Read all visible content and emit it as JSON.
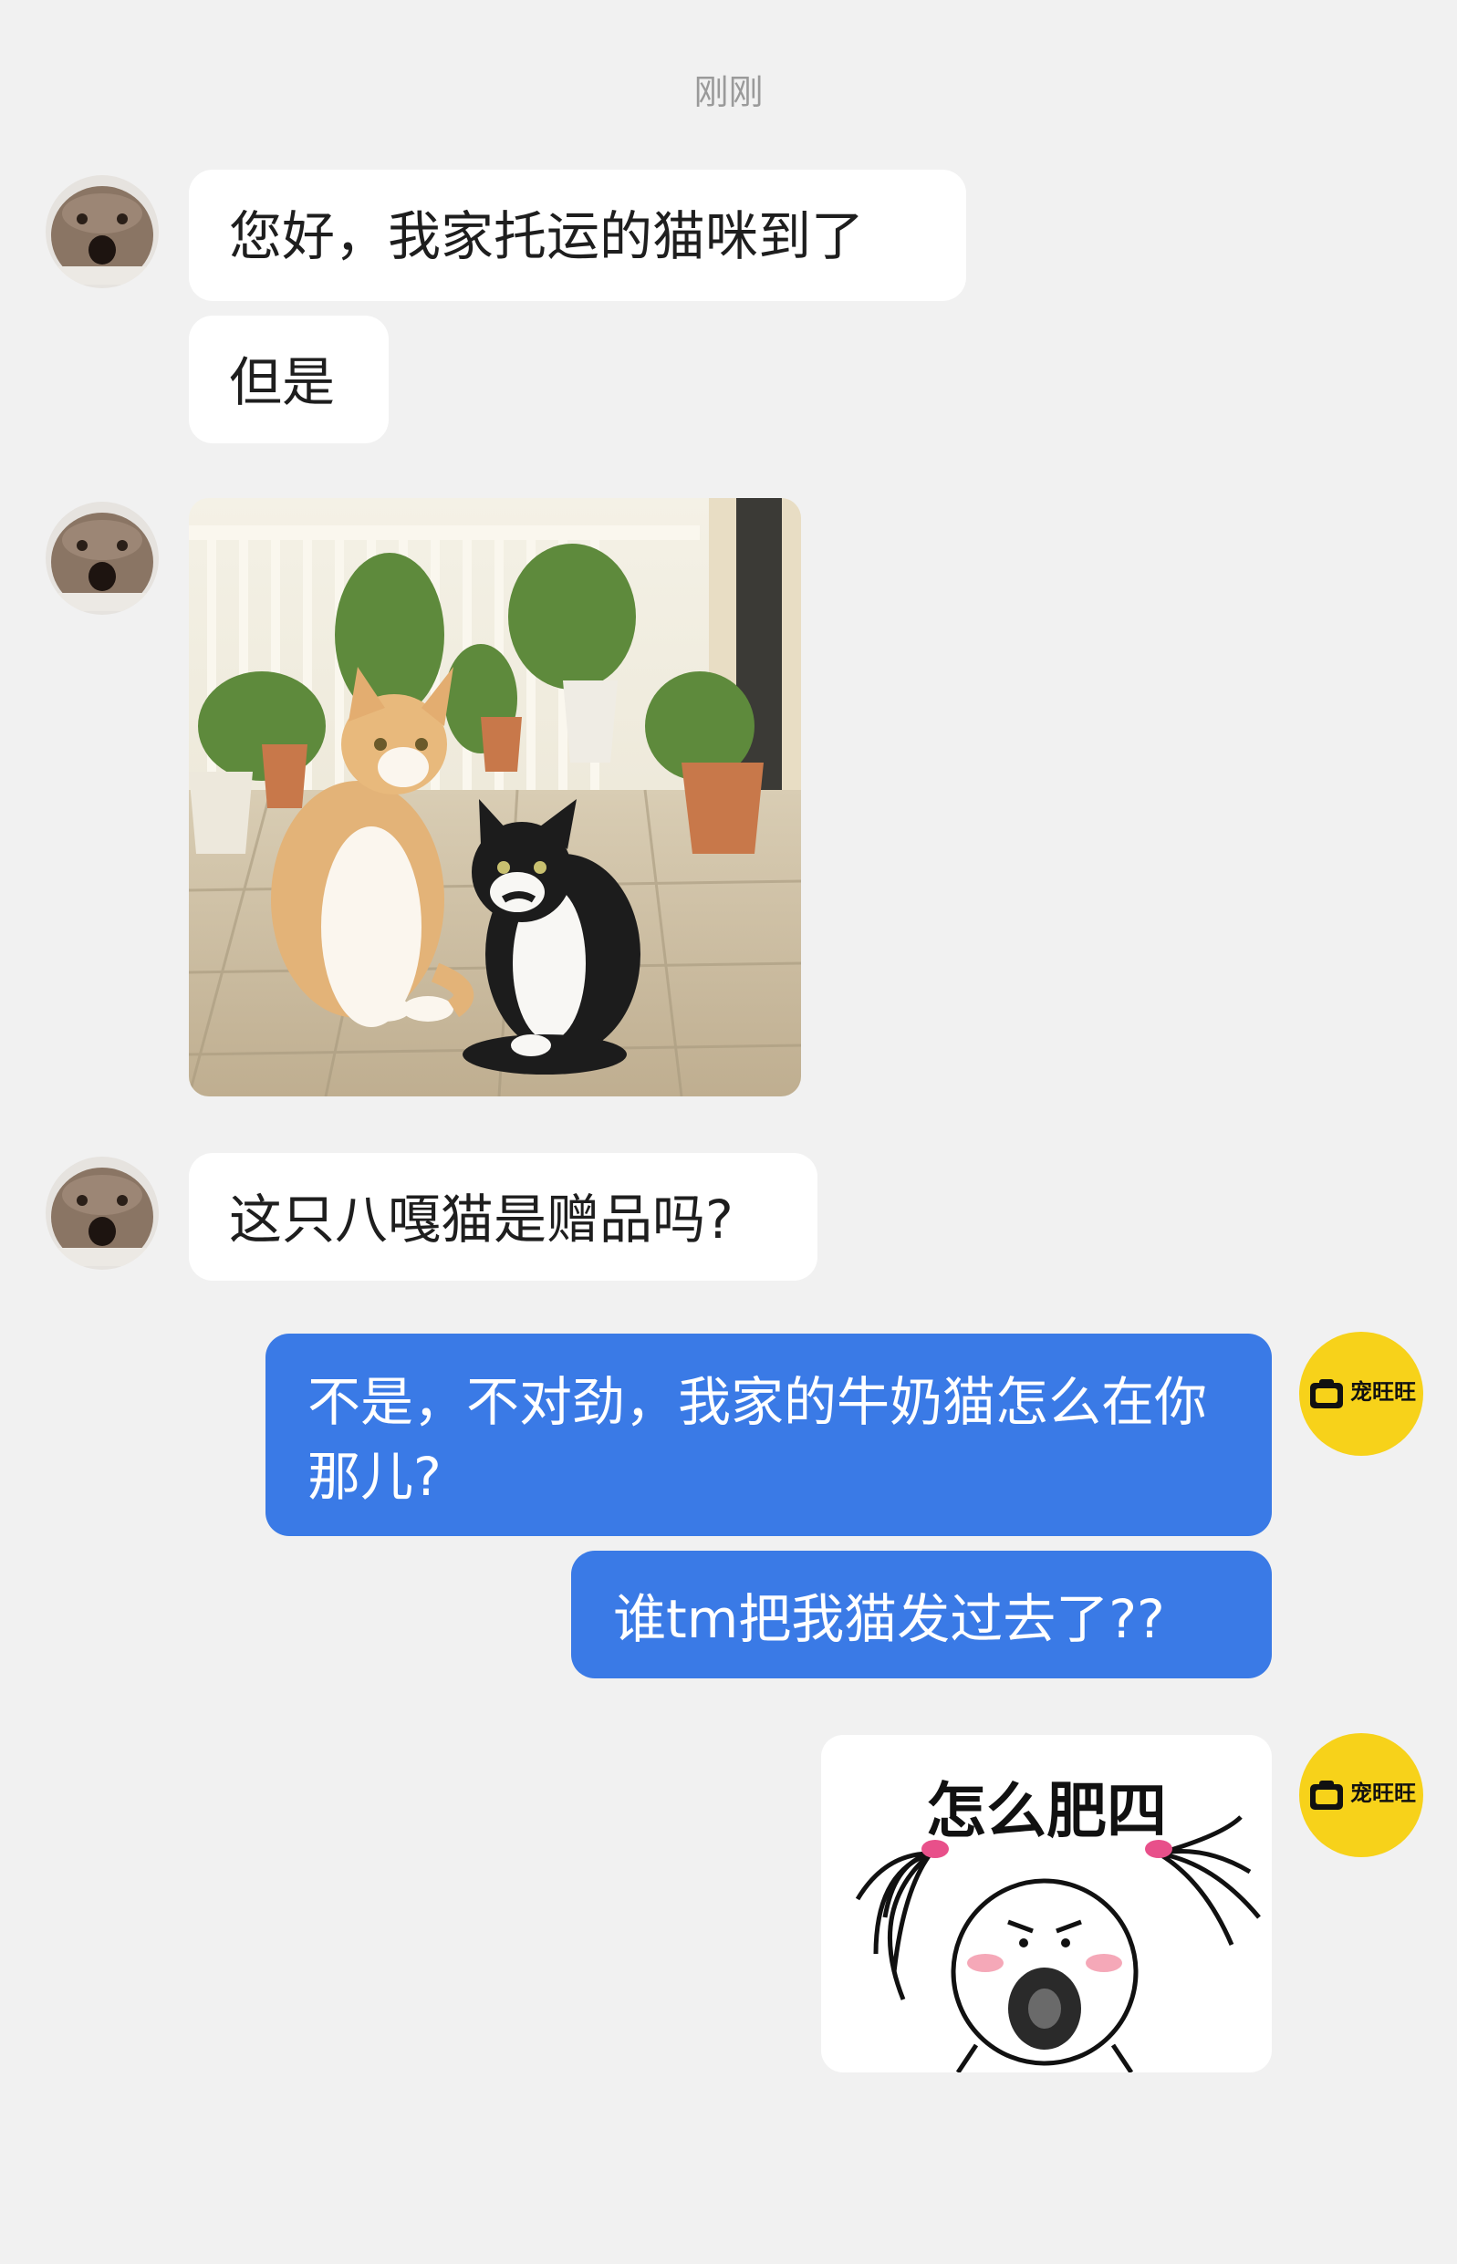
{
  "timestamp": "刚刚",
  "messages": {
    "m1": "您好，我家托运的猫咪到了",
    "m2": "但是",
    "m4": "这只八嘎猫是赠品吗?",
    "m5": "不是，不对劲，我家的牛奶猫怎么在你那儿?",
    "m6": "谁tm把我猫发过去了??"
  },
  "sticker_caption": "怎么肥四",
  "shop": {
    "name": "宠旺旺"
  },
  "colors": {
    "background": "#f1f1f1",
    "incoming_bubble": "#ffffff",
    "outgoing_bubble": "#3a7ae6",
    "shop_avatar": "#f7d21a"
  }
}
